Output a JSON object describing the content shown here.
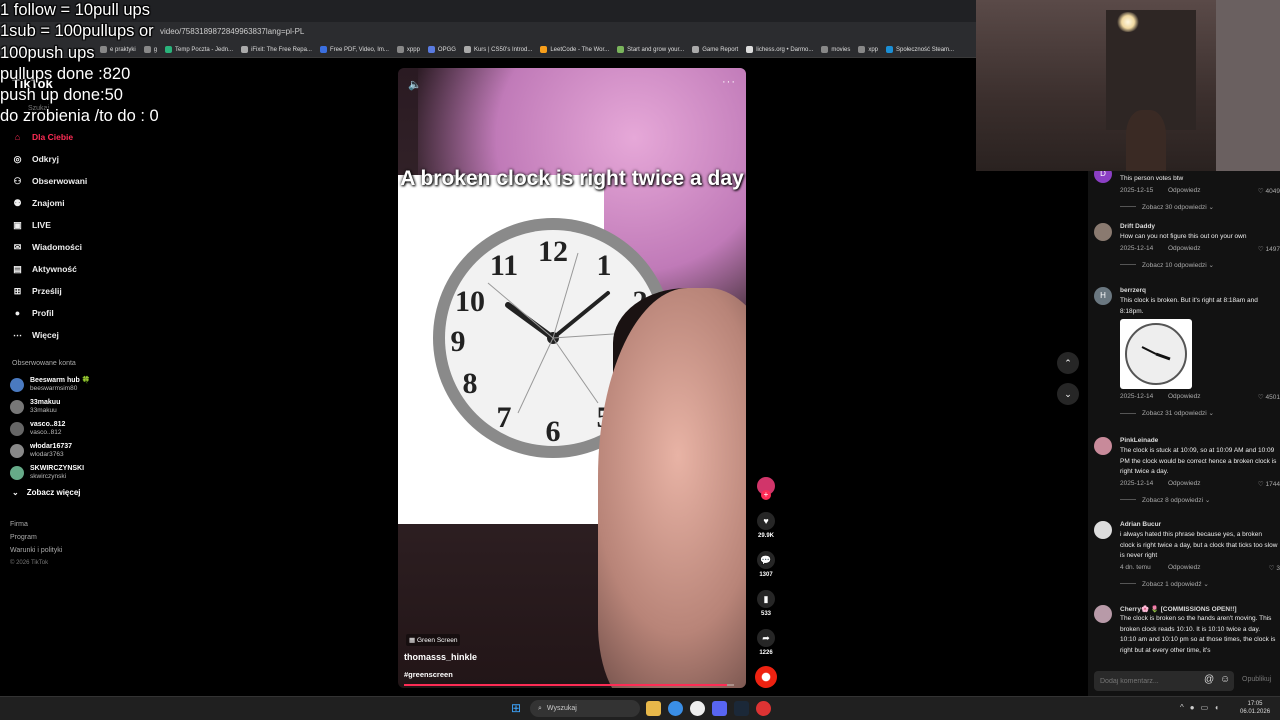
{
  "overlay_lines": [
    "1 follow = 10pull ups",
    "1sub = 100pullups or",
    "100push ups",
    "pullups done :820",
    "push up done:50",
    "do zrobienia /to do : 0"
  ],
  "browser": {
    "url": "video/7583189872849963837lang=pl-PL",
    "bookmarks": [
      {
        "label": "e praktyki",
        "color": "#888"
      },
      {
        "label": "g",
        "color": "#888"
      },
      {
        "label": "Temp Poczta - Jedn...",
        "color": "#2ab37b"
      },
      {
        "label": "iFixit: The Free Repa...",
        "color": "#aaa"
      },
      {
        "label": "Free PDF, Video, Im...",
        "color": "#3b6fe0"
      },
      {
        "label": "xppp",
        "color": "#888"
      },
      {
        "label": "OPGG",
        "color": "#5a7be0"
      },
      {
        "label": "Kurs | CS50's Introd...",
        "color": "#aaa"
      },
      {
        "label": "LeetCode - The Wor...",
        "color": "#f89f1b"
      },
      {
        "label": "Start and grow your...",
        "color": "#7ab55c"
      },
      {
        "label": "Game Report",
        "color": "#aaa"
      },
      {
        "label": "lichess.org • Darmo...",
        "color": "#ddd"
      },
      {
        "label": "movies",
        "color": "#888"
      },
      {
        "label": "xpp",
        "color": "#888"
      },
      {
        "label": "Społeczność Steam...",
        "color": "#1b8fd6"
      }
    ]
  },
  "sidebar": {
    "logo": "TikTok",
    "search_hint": "Szukaj",
    "nav": [
      {
        "label": "Dla Ciebie",
        "icon": "home-icon",
        "glyph": "⌂",
        "active": true
      },
      {
        "label": "Odkryj",
        "icon": "compass-icon",
        "glyph": "◎"
      },
      {
        "label": "Obserwowani",
        "icon": "user-follow-icon",
        "glyph": "⚇"
      },
      {
        "label": "Znajomi",
        "icon": "friends-icon",
        "glyph": "⚉"
      },
      {
        "label": "LIVE",
        "icon": "live-icon",
        "glyph": "▣"
      },
      {
        "label": "Wiadomości",
        "icon": "messages-icon",
        "glyph": "✉"
      },
      {
        "label": "Aktywność",
        "icon": "activity-icon",
        "glyph": "▤"
      },
      {
        "label": "Prześlij",
        "icon": "upload-icon",
        "glyph": "⊞"
      },
      {
        "label": "Profil",
        "icon": "profile-icon",
        "glyph": "●"
      },
      {
        "label": "Więcej",
        "icon": "more-icon",
        "glyph": "⋯"
      }
    ],
    "following_heading": "Obserwowane konta",
    "following": [
      {
        "name": "Beeswarm hub 🍀",
        "handle": "beeswarmsim80",
        "color": "#4a7ac0"
      },
      {
        "name": "33makuu",
        "handle": "33makuu",
        "color": "#777"
      },
      {
        "name": "vasco..812",
        "handle": "vasco..812",
        "color": "#666"
      },
      {
        "name": "włodar16737",
        "handle": "wlodar3763",
        "color": "#888"
      },
      {
        "name": "SKWIRCZYNSKI",
        "handle": "skwirczynski",
        "color": "#6a8"
      }
    ],
    "see_more": "Zobacz więcej",
    "footer": [
      "Firma",
      "Program",
      "Warunki i polityki"
    ],
    "copyright": "© 2026 TikTok"
  },
  "video": {
    "caption": "A broken clock is right twice a day",
    "tag_chip": "Green Screen",
    "author": "thomasss_hinkle",
    "hashtag": "#greenscreen",
    "progress": 0.98,
    "actions": {
      "likes": "29.9K",
      "comments": "1307",
      "saves": "533",
      "shares": "1226"
    }
  },
  "comments": [
    {
      "user": "D",
      "avatar_letter": "D",
      "avatar_color": "#8b3fc4",
      "text": "This person votes btw",
      "date": "2025-12-15",
      "reply": "Odpowiedz",
      "likes": "4049",
      "more": "Zobacz 30 odpowiedzi"
    },
    {
      "user": "Drift Daddy",
      "avatar_letter": "",
      "avatar_color": "#8a7a70",
      "text": "How can you not figure this out on your own",
      "date": "2025-12-14",
      "reply": "Odpowiedz",
      "likes": "1497",
      "more": "Zobacz 10 odpowiedzi"
    },
    {
      "user": "berrzerq",
      "avatar_letter": "H",
      "avatar_color": "#6a7780",
      "text": "This clock is broken. But it's right at 8:18am and 8:18pm.",
      "date": "2025-12-14",
      "reply": "Odpowiedz",
      "likes": "4501",
      "more": "Zobacz 31 odpowiedzi"
    },
    {
      "user": "PinkLeinade",
      "avatar_letter": "",
      "avatar_color": "#c88a9a",
      "text": "The clock is stuck at 10:09, so at 10:09 AM and 10:09 PM the clock would be correct hence a broken clock is right twice a day.",
      "date": "2025-12-14",
      "reply": "Odpowiedz",
      "likes": "1744",
      "more": "Zobacz 8 odpowiedzi"
    },
    {
      "user": "Adrian Bucur",
      "avatar_letter": "",
      "avatar_color": "#ddd",
      "text": "i always hated this phrase because yes, a broken clock is right twice a day, but a clock that ticks too slow is never right",
      "date": "4 dn. temu",
      "reply": "Odpowiedz",
      "likes": "3",
      "more": "Zobacz 1 odpowiedź"
    },
    {
      "user": "Cherry🌸 🌷 [COMMISSIONS OPEN!!]",
      "avatar_letter": "",
      "avatar_color": "#b89aa8",
      "text": "The clock is broken so the hands aren't moving. This broken clock reads 10:10. It is 10:10 twice a day. 10:10 am and 10:10 pm so at those times, the clock is right but at every other time, it's",
      "date": "",
      "reply": "",
      "likes": "",
      "more": ""
    }
  ],
  "comment_bar": {
    "placeholder": "Dodaj komentarz...",
    "post": "Opublikuj"
  },
  "taskbar": {
    "search": "Wyszukaj",
    "time": "17:05",
    "date": "06.01.2026"
  }
}
